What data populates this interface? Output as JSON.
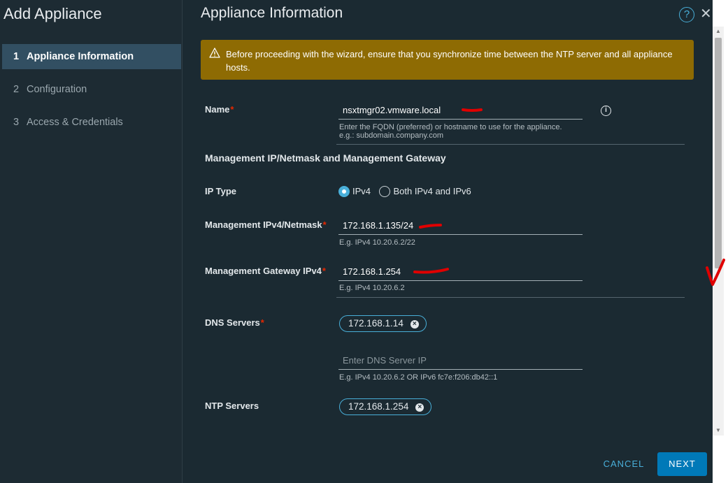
{
  "sidebar": {
    "title": "Add Appliance",
    "steps": [
      {
        "number": "1",
        "label": "Appliance Information"
      },
      {
        "number": "2",
        "label": "Configuration"
      },
      {
        "number": "3",
        "label": "Access & Credentials"
      }
    ]
  },
  "main": {
    "title": "Appliance Information",
    "alert_text": "Before proceeding with the wizard, ensure that you synchronize time between the NTP server and all appliance hosts.",
    "name": {
      "label": "Name",
      "value": "nsxtmgr02.vmware.local",
      "hint_line1": "Enter the FQDN (preferred) or hostname to use for the appliance.",
      "hint_line2": "e.g.: subdomain.company.com"
    },
    "section_title": "Management IP/Netmask and Management Gateway",
    "ip_type": {
      "label": "IP Type",
      "options": [
        "IPv4",
        "Both IPv4 and IPv6"
      ],
      "selected": "IPv4"
    },
    "mgmt_ip": {
      "label": "Management IPv4/Netmask",
      "value": "172.168.1.135/24",
      "hint": "E.g. IPv4 10.20.6.2/22"
    },
    "mgmt_gw": {
      "label": "Management Gateway IPv4",
      "value": "172.168.1.254",
      "hint": "E.g. IPv4 10.20.6.2"
    },
    "dns": {
      "label": "DNS Servers",
      "chips": [
        "172.168.1.14"
      ],
      "placeholder": "Enter DNS Server IP",
      "hint": "E.g. IPv4 10.20.6.2 OR IPv6 fc7e:f206:db42::1"
    },
    "ntp": {
      "label": "NTP Servers",
      "chips": [
        "172.168.1.254"
      ]
    }
  },
  "footer": {
    "cancel_label": "CANCEL",
    "next_label": "NEXT"
  },
  "icons": {
    "help": "help-circle-icon",
    "close": "close-icon",
    "warning": "warning-triangle-icon",
    "info": "info-circle-icon",
    "chip_remove": "remove-circle-icon"
  },
  "colors": {
    "background": "#1b2a32",
    "sidebar_active": "#324f62",
    "alert_bg": "#8e6b03",
    "accent": "#49afd9",
    "primary_button": "#0079b8",
    "required": "#e62700",
    "annotation": "#e00000"
  }
}
